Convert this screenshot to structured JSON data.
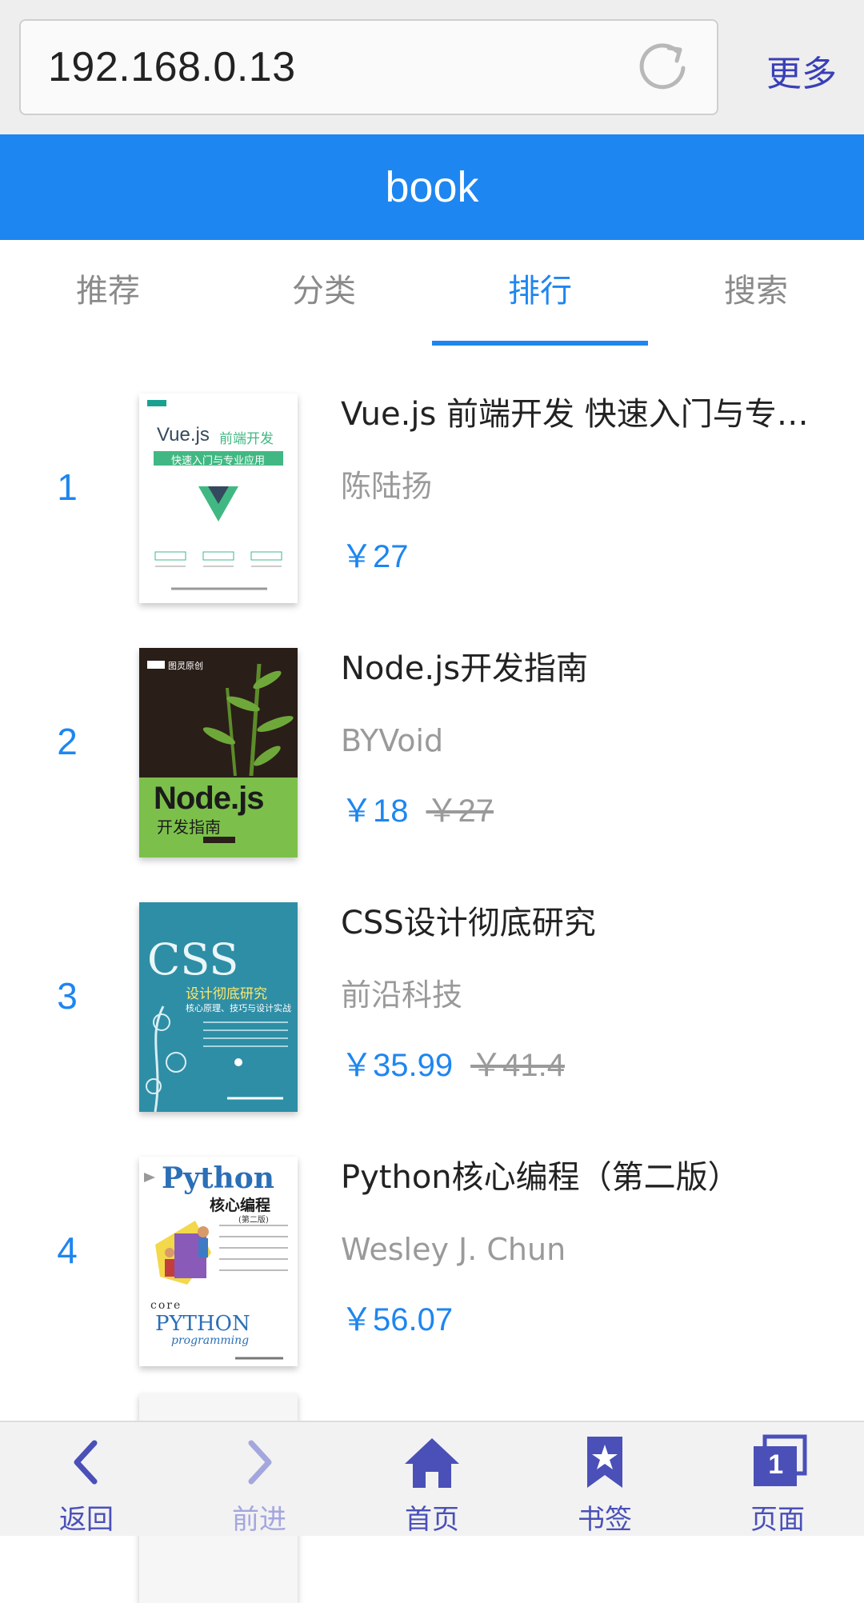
{
  "browser": {
    "url": "192.168.0.13",
    "more_label": "更多"
  },
  "app": {
    "title": "book"
  },
  "tabs": [
    {
      "label": "推荐",
      "active": false
    },
    {
      "label": "分类",
      "active": false
    },
    {
      "label": "排行",
      "active": true
    },
    {
      "label": "搜索",
      "active": false
    }
  ],
  "books": [
    {
      "rank": "1",
      "title": "Vue.js 前端开发 快速入门与专…",
      "author": "陈陆扬",
      "price": "￥27",
      "old_price": "",
      "cover": {
        "main": "Vue.js",
        "accent": "前端开发",
        "sub": "快速入门与专业应用",
        "color": "#ffffff"
      }
    },
    {
      "rank": "2",
      "title": "Node.js开发指南",
      "author": "BYVoid",
      "price": "￥18",
      "old_price": "￥27",
      "cover": {
        "main": "Node.js",
        "sub": "开发指南",
        "series": "图灵原创",
        "color": "#2a1e18"
      }
    },
    {
      "rank": "3",
      "title": "CSS设计彻底研究",
      "author": "前沿科技",
      "price": "￥35.99",
      "old_price": "￥41.4",
      "cover": {
        "main": "CSS",
        "sub": "设计彻底研究",
        "tag": "核心原理、技巧与设计实战",
        "color": "#2e8ea6"
      }
    },
    {
      "rank": "4",
      "title": "Python核心编程（第二版）",
      "author": "Wesley J. Chun",
      "price": "￥56.07",
      "old_price": "",
      "cover": {
        "main": "Python",
        "sub": "核心编程",
        "edition": "(第二版)",
        "footer_top": "core",
        "footer_main": "PYTHON",
        "footer_sub": "programming",
        "color": "#ffffff"
      }
    }
  ],
  "bottom_bar": [
    {
      "label": "返回",
      "icon": "chevron-left-icon",
      "enabled": true
    },
    {
      "label": "前进",
      "icon": "chevron-right-icon",
      "enabled": false
    },
    {
      "label": "首页",
      "icon": "home-icon",
      "enabled": true
    },
    {
      "label": "书签",
      "icon": "bookmark-star-icon",
      "enabled": true
    },
    {
      "label": "页面",
      "icon": "pages-icon",
      "enabled": true,
      "badge": "1"
    }
  ],
  "colors": {
    "accent": "#1e86f0",
    "toolbar_icon": "#4a50b8"
  }
}
